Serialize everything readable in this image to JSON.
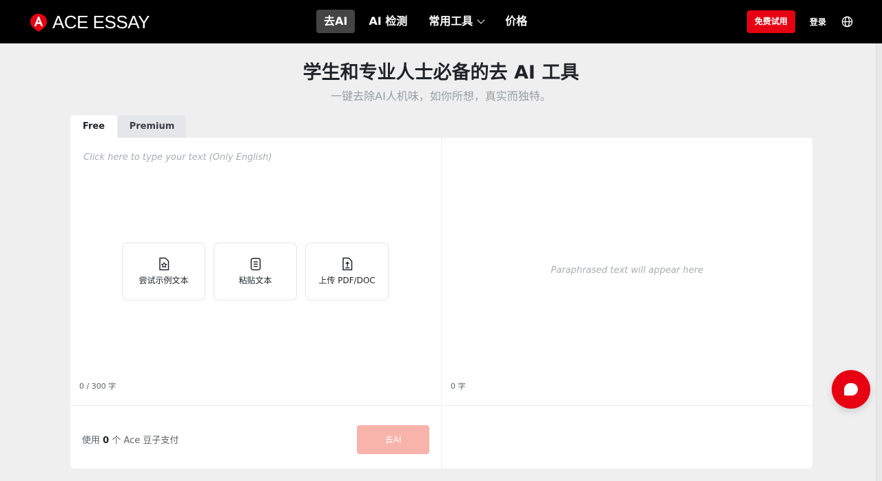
{
  "brand": {
    "name": "ACE ESSAY",
    "accent": "#e60012"
  },
  "nav": {
    "items": [
      {
        "label": "去AI",
        "active": true
      },
      {
        "label": "AI 检测",
        "active": false
      },
      {
        "label": "常用工具",
        "active": false,
        "dropdown": true
      },
      {
        "label": "价格",
        "active": false
      }
    ],
    "trial_label": "免费试用",
    "login_label": "登录",
    "language_icon": "globe-icon"
  },
  "hero": {
    "title": "学生和专业人士必备的去 AI 工具",
    "subtitle": "一键去除AI人机味，如你所想，真实而独特。"
  },
  "tabs": [
    {
      "label": "Free",
      "active": true
    },
    {
      "label": "Premium",
      "active": false
    }
  ],
  "editor": {
    "input_placeholder": "Click here to type your text (Only English)",
    "output_placeholder": "Paraphrased text will appear here",
    "actions": [
      {
        "label": "尝试示例文本",
        "icon": "file-star-icon"
      },
      {
        "label": "粘贴文本",
        "icon": "clipboard-text-icon"
      },
      {
        "label": "上传 PDF/DOC",
        "icon": "file-upload-icon"
      }
    ],
    "input_count": "0 / 300 字",
    "output_count": "0 字",
    "pay_prefix": "使用",
    "pay_amount": "0",
    "pay_suffix": "个 Ace 豆子支付",
    "submit_label": "去AI"
  },
  "chat": {
    "icon": "chat-bubble-icon"
  }
}
